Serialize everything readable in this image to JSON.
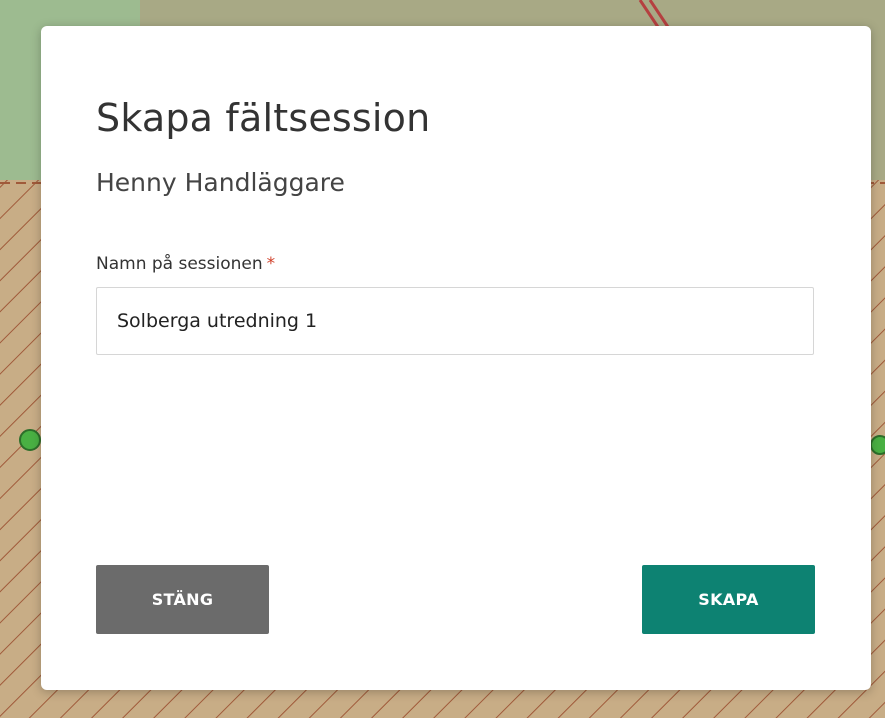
{
  "dialog": {
    "title": "Skapa fältsession",
    "subtitle": "Henny Handläggare",
    "field": {
      "label": "Namn på sessionen",
      "required_mark": "*",
      "value": "Solberga utredning 1"
    },
    "buttons": {
      "close_label": "STÄNG",
      "create_label": "SKAPA"
    }
  },
  "colors": {
    "primary": "#0d8272",
    "secondary": "#6b6b6b",
    "required": "#d0402a"
  }
}
